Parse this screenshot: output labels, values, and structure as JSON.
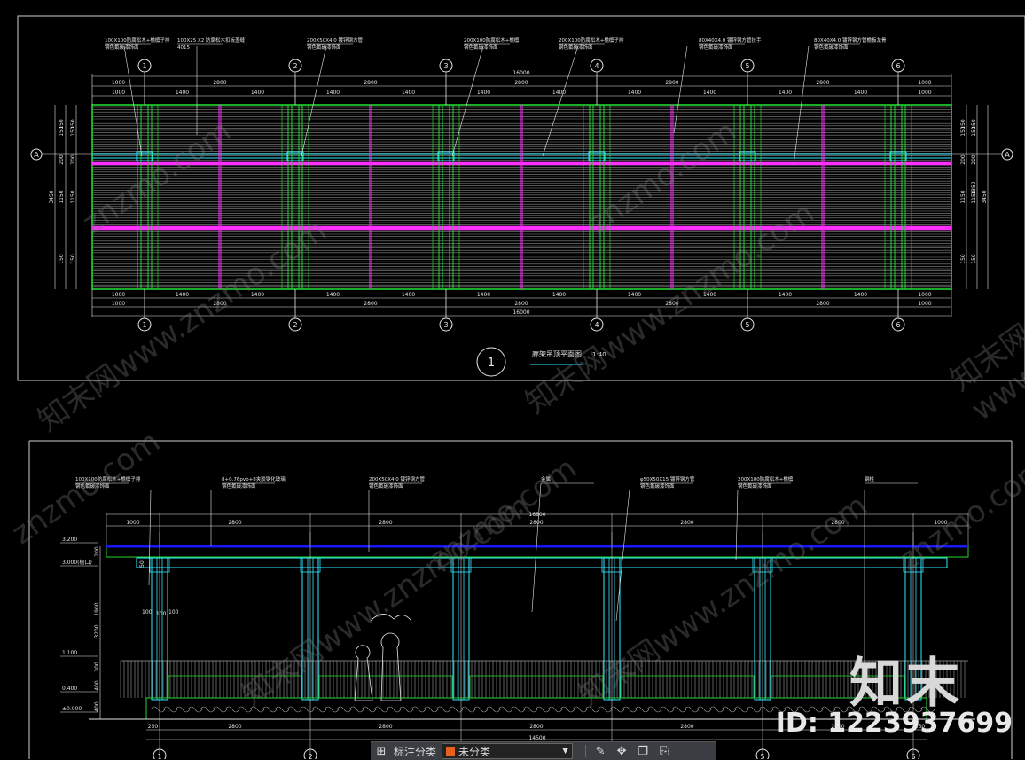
{
  "colors": {
    "green": "#22d630",
    "magenta": "#ff30ff",
    "cyan": "#30e8ff",
    "blue": "#1818ff",
    "white": "#e6e6e6",
    "frame": "#cfcfcf",
    "hatch": "#8a8a8a",
    "brand_orange": "#e8601c"
  },
  "plan": {
    "notes": [
      "100X100防腐松木+檐檩子排",
      "100X25 X2 防腐松木扣板盖缝",
      "200X50X4.0 镀锌钢方管",
      "200X100防腐松木+檐檩",
      "200X100防腐松木+檐檩子排",
      "80X40X4.0 镀锌钢方管扶手",
      "80X40X4.0 镀锌钢方管檐板龙骨"
    ],
    "notes_sub": [
      "钢色氟碳漆饰面",
      "4015",
      "钢色氟碳漆饰面",
      "钢色氟碳漆饰面",
      "钢色氟碳漆饰面",
      "钢色氟碳漆饰面",
      "钢色氟碳漆饰面"
    ],
    "grid_labels": [
      "1",
      "2",
      "3",
      "4",
      "5",
      "6"
    ],
    "axis_label": "A",
    "total_dim": "16000",
    "half_dims": [
      "1000",
      "2800",
      "2800",
      "2800",
      "2800",
      "2800",
      "1000"
    ],
    "small_dims": [
      "1000",
      "1400",
      "1400",
      "1400",
      "1400",
      "1400",
      "1400",
      "1400",
      "1400",
      "1400",
      "1400",
      "1000"
    ],
    "side_dims_left": [
      "150",
      "150",
      "200",
      "1150",
      "150",
      "150"
    ],
    "side_total": "3450",
    "side_mid": "1350",
    "title_no": "1",
    "title": "廊架吊顶平面图",
    "scale": "1:40"
  },
  "elevation": {
    "notes": [
      "100X100防腐松木+檐檩子排",
      "8+0.76pvb+8夹胶钢化玻璃",
      "200X50X4.0 镀锌钢方管",
      "金属",
      "φ50X50X15 镀锌钢方管",
      "200X100防腐松木+檐檩",
      "钢柱"
    ],
    "notes_sub": [
      "钢色氟碳漆饰面",
      "钢色氟碳漆饰面",
      "钢色氟碳漆饰面",
      "",
      "钢色氟碳漆饰面",
      "钢色氟碳漆饰面",
      ""
    ],
    "top_total": "16800",
    "top_dims": [
      "1000",
      "2800",
      "2800",
      "2800",
      "2800",
      "2800",
      "1000"
    ],
    "bottom_dims": [
      "250",
      "2800",
      "2800",
      "2800",
      "2800",
      "2800",
      "250"
    ],
    "bottom_total": "14500",
    "levels": [
      "3.200",
      "3.000(檐口)",
      "1.100",
      "0.400",
      "±0.000"
    ],
    "left_dims": [
      "200",
      "1900",
      "3200",
      "300",
      "400",
      "400"
    ],
    "col_dims": [
      "100",
      "100",
      "100"
    ],
    "grid_labels": [
      "1",
      "2",
      "3",
      "4",
      "5",
      "6"
    ]
  },
  "watermark": {
    "logo": "知末",
    "id": "ID: 1223937699",
    "faint": "znzmo.com",
    "faint_cn": "知末网www.znzmo.com"
  },
  "toolbar": {
    "label": "标注分类",
    "selected": "未分类",
    "icons": [
      "grid-icon",
      "edit-icon",
      "move-icon",
      "copy-icon",
      "paste-icon"
    ]
  }
}
